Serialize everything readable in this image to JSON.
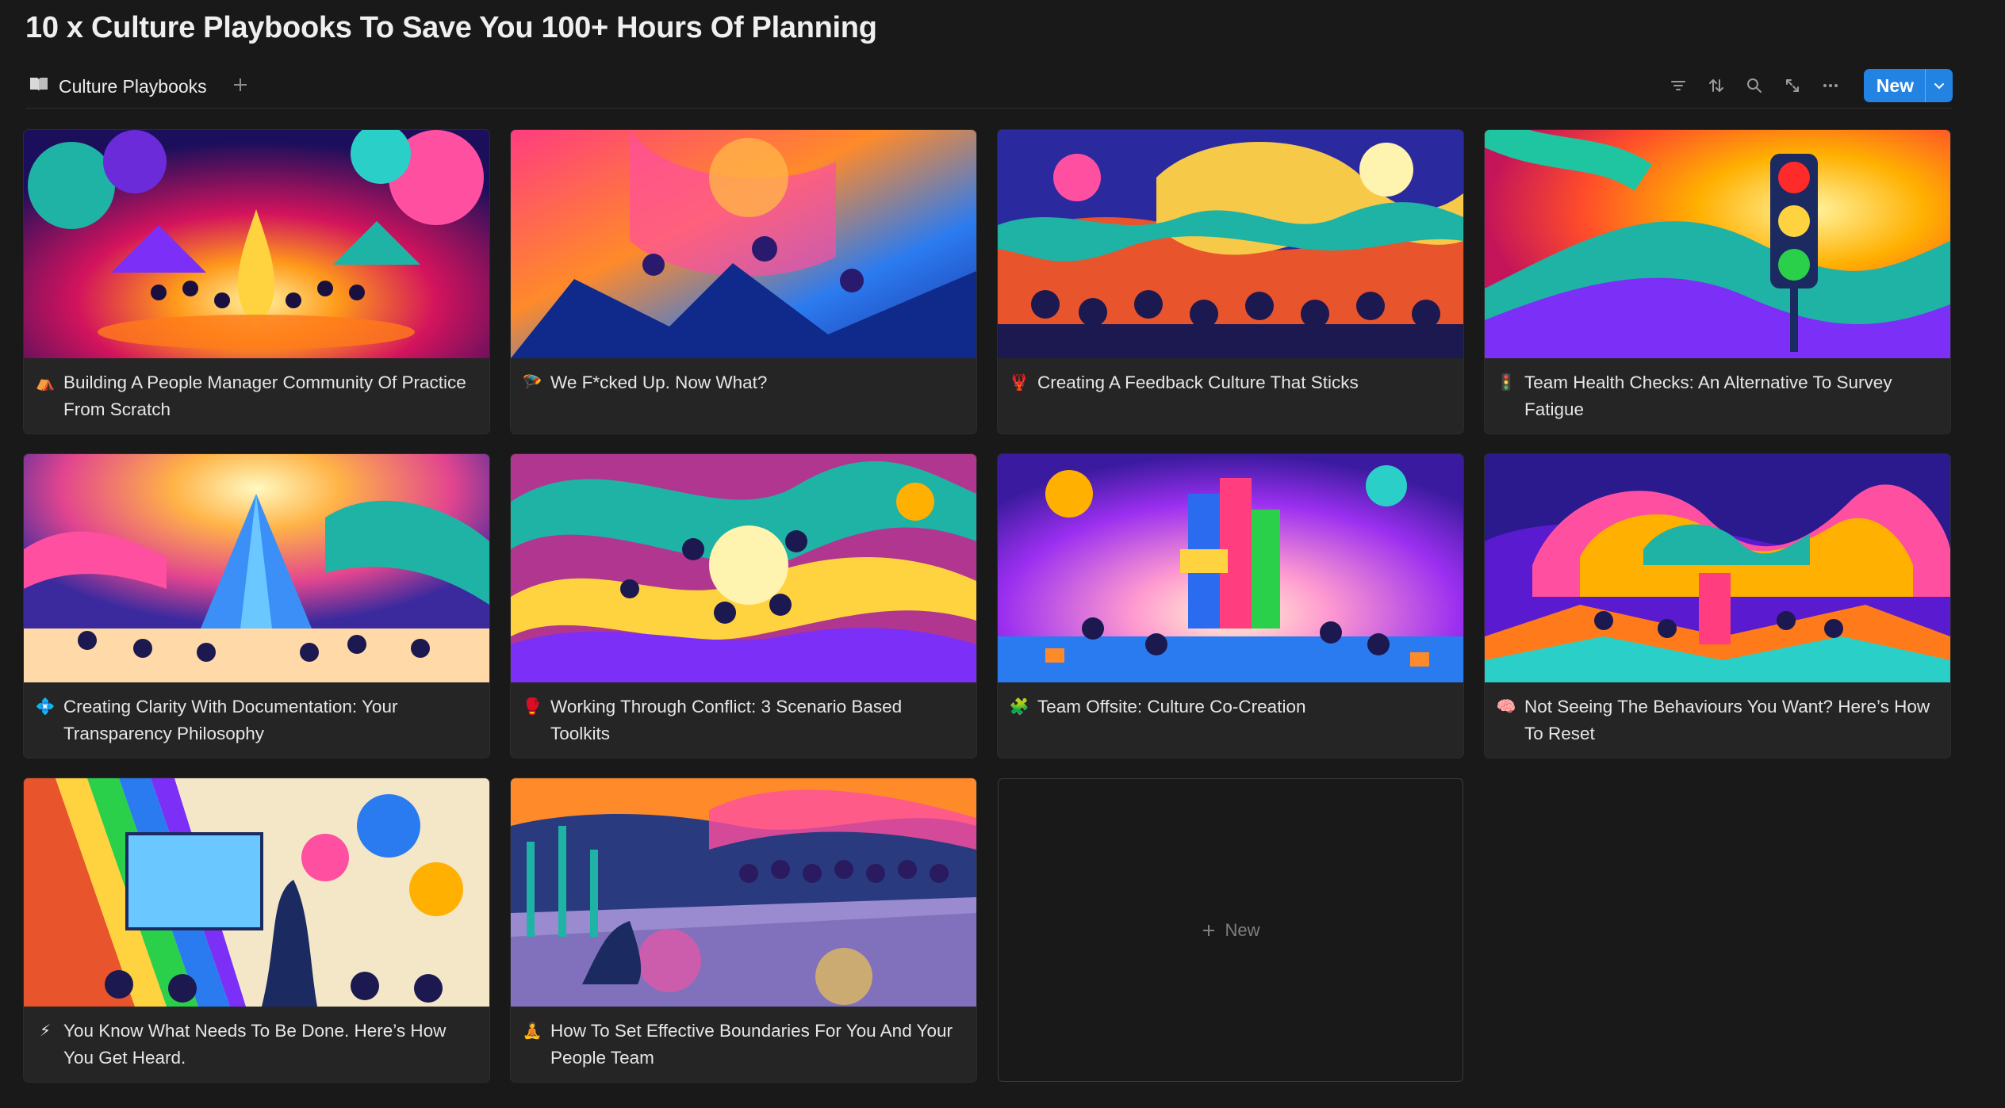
{
  "page": {
    "title": "10 x Culture Playbooks To Save You 100+ Hours Of Planning"
  },
  "view": {
    "tab_label": "Culture Playbooks",
    "new_label": "New"
  },
  "cards": [
    {
      "emoji": "⛺",
      "title": "Building A People Manager Community Of Practice From Scratch",
      "cover": "campfire-gathering"
    },
    {
      "emoji": "🪂",
      "title": "We F*cked Up. Now What?",
      "cover": "chaotic-fall"
    },
    {
      "emoji": "🦞",
      "title": "Creating A Feedback Culture That Sticks",
      "cover": "crowd-ideas"
    },
    {
      "emoji": "🚦",
      "title": "Team Health Checks: An Alternative To Survey Fatigue",
      "cover": "traffic-light"
    },
    {
      "emoji": "💠",
      "title": "Creating Clarity With Documentation: Your Transparency Philosophy",
      "cover": "crystal-pyramid"
    },
    {
      "emoji": "🥊",
      "title": "Working Through Conflict: 3 Scenario Based Toolkits",
      "cover": "conflict-swirl"
    },
    {
      "emoji": "🧩",
      "title": "Team Offsite: Culture Co-Creation",
      "cover": "block-tower"
    },
    {
      "emoji": "🧠",
      "title": "Not Seeing The Behaviours You Want? Here’s How To Reset",
      "cover": "brain-tree"
    },
    {
      "emoji": "⚡",
      "title": "You Know What Needs To Be Done. Here’s How You Get Heard.",
      "cover": "presentation-rainbow"
    },
    {
      "emoji": "🧘",
      "title": "How To Set Effective Boundaries For You And Your People Team",
      "cover": "boundary-drawing"
    }
  ],
  "new_card_label": "New",
  "icons": [
    "book-icon",
    "plus-icon",
    "filter-icon",
    "sort-icon",
    "search-icon",
    "expand-icon",
    "more-icon",
    "chevron-down-icon"
  ]
}
